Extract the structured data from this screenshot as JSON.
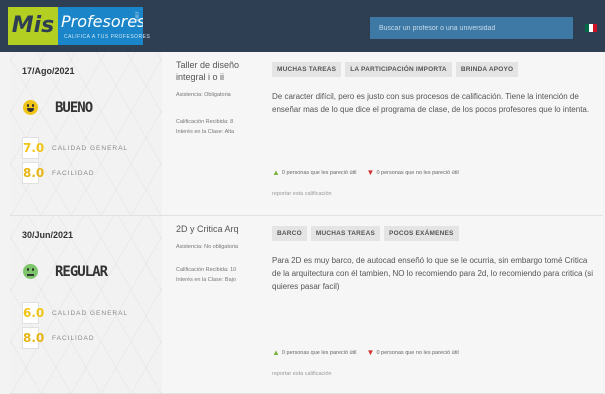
{
  "header": {
    "logo_mis": "Mis",
    "logo_profesores": "Profesores",
    "logo_sub": "CALIFICA A TUS PROFESORES",
    "logo_com": ".com",
    "search_placeholder": "Buscar un profesor o una universidad",
    "flag_colors": [
      "#006847",
      "#ffffff",
      "#ce1126"
    ]
  },
  "ratings": [
    {
      "date": "17/Ago/2021",
      "face_color": "#f0c419",
      "quality": "BUENO",
      "general_score": "7.0",
      "general_label": "CALIDAD GENERAL",
      "ease_score": "8.0",
      "ease_label": "FACILIDAD",
      "course": "Taller de diseño integral i o ii",
      "attendance": "Asistencia: Obligatoria",
      "grade": "Calificación Recibida: 8",
      "interest": "Interés en la Clase: Alta",
      "tags": [
        "MUCHAS TAREAS",
        "LA PARTICIPACIÓN IMPORTA",
        "BRINDA APOYO"
      ],
      "comment": "De caracter difícil, pero es justo con sus procesos de calificación. Tiene la intención de enseñar mas de lo que dice el programa de clase, de los pocos profesores que lo intenta.",
      "useful": "0 personas que les pareció útil",
      "not_useful": "0 personas que no les pareció útil",
      "report": "reportar esta calificación"
    },
    {
      "date": "30/Jun/2021",
      "face_color": "#7ec66b",
      "quality": "REGULAR",
      "general_score": "6.0",
      "general_label": "CALIDAD GENERAL",
      "ease_score": "8.0",
      "ease_label": "FACILIDAD",
      "course": "2D y Critica Arq",
      "attendance": "Asistencia: No obligatoria",
      "grade": "Calificación Recibida: 10",
      "interest": "Interés en la Clase: Bajo",
      "tags": [
        "BARCO",
        "MUCHAS TAREAS",
        "POCOS EXÁMENES"
      ],
      "comment": "Para 2D es muy barco, de autocad enseñó lo que se le ocurria, sin embargo tomé Critica de la arquitectura con él tambien, NO lo recomiendo para 2d, lo recomiendo para critica (si quieres pasar facil)",
      "useful": "0 personas que les pareció útil",
      "not_useful": "0 personas que no les pareció útil",
      "report": "reportar esta calificación"
    }
  ],
  "colors": {
    "score_good": "#f0c419",
    "score_mid": "#e8b516",
    "thumb_up": "#7cb342",
    "thumb_down": "#d32f2f"
  }
}
